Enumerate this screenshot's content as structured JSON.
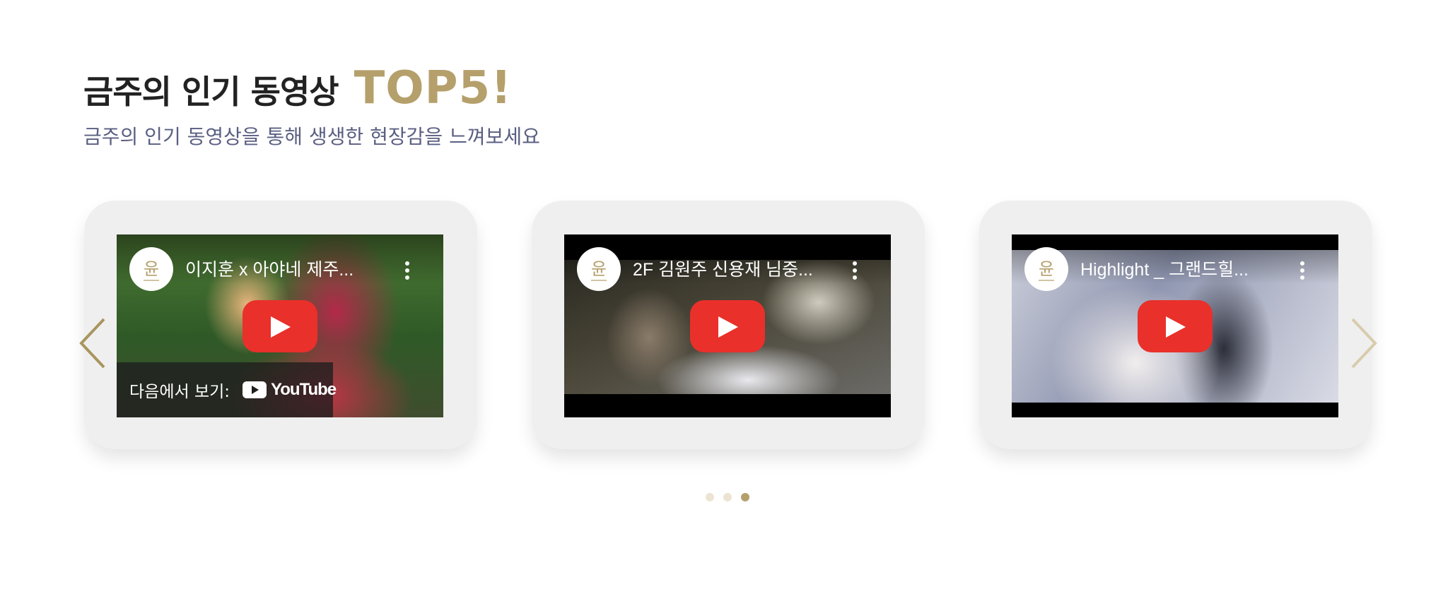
{
  "section": {
    "title_main": "금주의 인기 동영상",
    "title_accent": "TOP5!",
    "subtitle": "금주의 인기 동영상을 통해 생생한 현장감을 느껴보세요"
  },
  "videos": [
    {
      "title": "이지훈 x 아야네 제주...",
      "watch_on_label": "다음에서 보기:",
      "youtube_word": "YouTube",
      "channel_logo_char": "윤"
    },
    {
      "title": "2F 김원주 신용재 님중...",
      "channel_logo_char": "윤"
    },
    {
      "title": "Highlight _ 그랜드힐...",
      "channel_logo_char": "윤"
    }
  ],
  "navigation": {
    "prev_icon": "chevron-left-icon",
    "next_icon": "chevron-right-icon"
  },
  "pagination": {
    "count": 3,
    "active_index": 2
  },
  "colors": {
    "accent_gold": "#b5a06c",
    "arrow_prev": "#a99560",
    "arrow_next": "#d8ccae",
    "dot_inactive": "#ece4d2",
    "dot_active": "#b5a06c",
    "subtitle": "#5a5f82",
    "youtube_red": "#e9302a"
  }
}
